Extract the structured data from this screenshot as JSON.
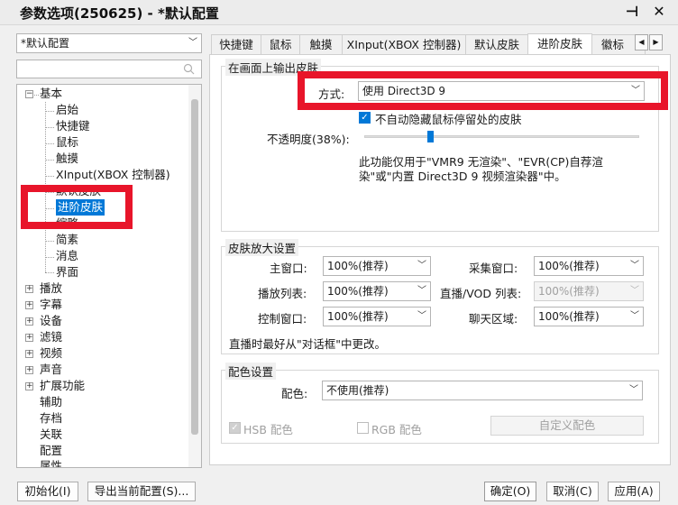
{
  "window": {
    "title": "参数选项(250625) - *默认配置",
    "pin_label": "⊣",
    "close_label": "✕"
  },
  "left": {
    "profile_value": "*默认配置",
    "search_placeholder": "",
    "tree": {
      "basic": "基本",
      "basic_children": [
        "启始",
        "快捷键",
        "鼠标",
        "触摸",
        "XInput(XBOX 控制器)",
        "默认皮肤",
        "进阶皮肤",
        "缩略",
        "简素",
        "消息",
        "界面"
      ],
      "collapsed": [
        "播放",
        "字幕",
        "设备",
        "滤镜",
        "视频",
        "声音",
        "扩展功能"
      ],
      "plain": [
        "辅助",
        "存档",
        "关联",
        "配置",
        "属性"
      ]
    }
  },
  "tabs": {
    "items": [
      "快捷键",
      "鼠标",
      "触摸",
      "XInput(XBOX 控制器)",
      "默认皮肤",
      "进阶皮肤",
      "徽标"
    ],
    "active_index": 5,
    "prev_label": "◀",
    "next_label": "▶"
  },
  "overlay_group": {
    "title": "在画面上输出皮肤",
    "mode_label": "方式:",
    "mode_value": "使用 Direct3D 9",
    "autohide_label": "不自动隐藏鼠标停留处的皮肤",
    "autohide_checked": true,
    "opacity_label": "不透明度(38%):",
    "opacity_value": 38,
    "note": "此功能仅用于\"VMR9 无渲染\"、\"EVR(CP)自荐渲染\"或\"内置 Direct3D 9 视频渲染器\"中。"
  },
  "zoom_group": {
    "title": "皮肤放大设置",
    "main_label": "主窗口:",
    "main_value": "100%(推荐)",
    "capture_label": "采集窗口:",
    "capture_value": "100%(推荐)",
    "playlist_label": "播放列表:",
    "playlist_value": "100%(推荐)",
    "live_label": "直播/VOD 列表:",
    "live_value": "100%(推荐)",
    "control_label": "控制窗口:",
    "control_value": "100%(推荐)",
    "chat_label": "聊天区域:",
    "chat_value": "100%(推荐)",
    "hint": "直播时最好从\"对话框\"中更改。"
  },
  "color_group": {
    "title": "配色设置",
    "color_label": "配色:",
    "color_value": "不使用(推荐)",
    "hsb_label": "HSB 配色",
    "rgb_label": "RGB 配色",
    "custom_label": "自定义配色"
  },
  "footer": {
    "init_label": "初始化(I)",
    "export_label": "导出当前配置(S)...",
    "ok_label": "确定(O)",
    "cancel_label": "取消(C)",
    "apply_label": "应用(A)"
  },
  "colors": {
    "accent": "#0078d7",
    "highlight_red": "#e8152a"
  }
}
